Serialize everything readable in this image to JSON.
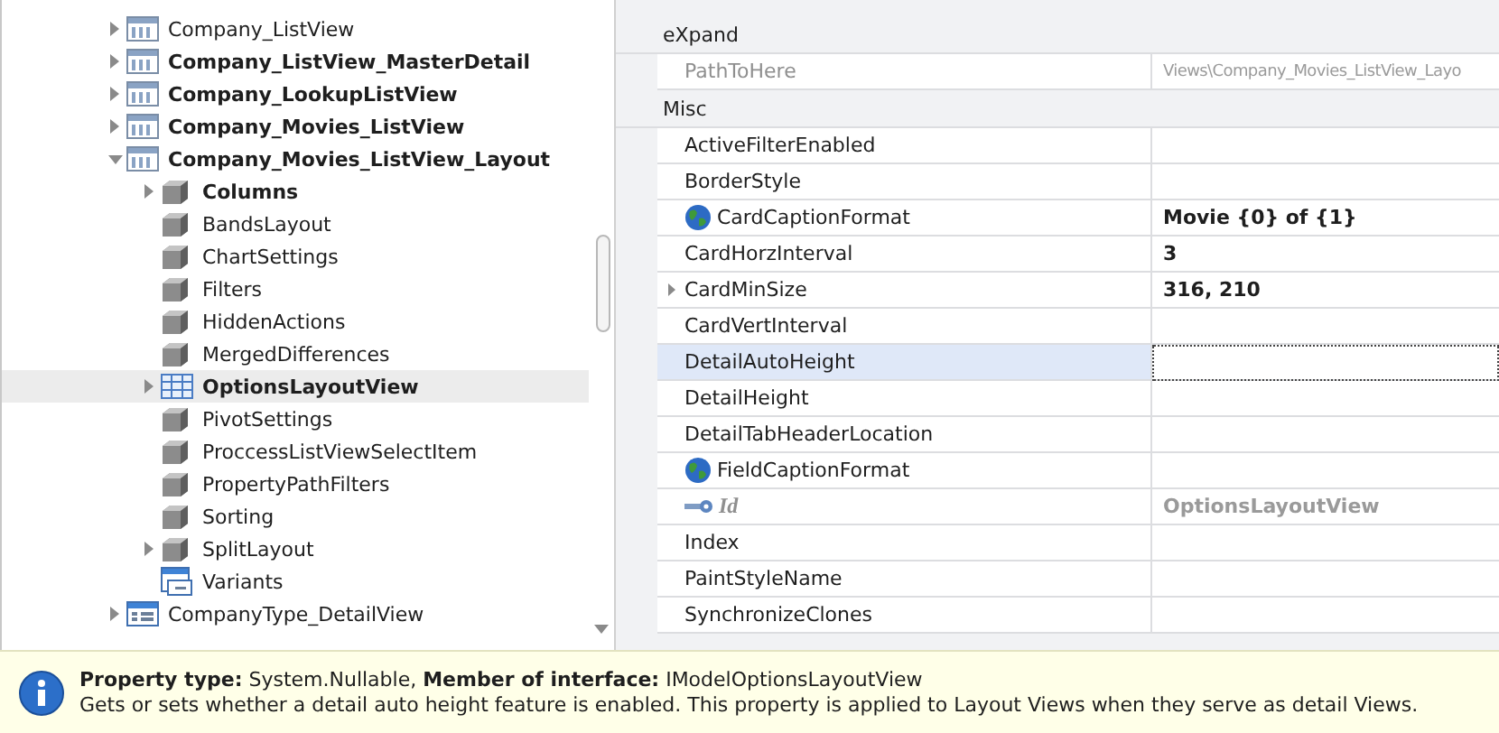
{
  "tree": {
    "items": [
      {
        "label": "Company_ListView",
        "kind": "listview",
        "bold": false,
        "expandable": true,
        "expanded": false,
        "selected": false
      },
      {
        "label": "Company_ListView_MasterDetail",
        "kind": "listview",
        "bold": true,
        "expandable": true,
        "expanded": false,
        "selected": false
      },
      {
        "label": "Company_LookupListView",
        "kind": "listview",
        "bold": true,
        "expandable": true,
        "expanded": false,
        "selected": false
      },
      {
        "label": "Company_Movies_ListView",
        "kind": "listview",
        "bold": true,
        "expandable": true,
        "expanded": false,
        "selected": false
      },
      {
        "label": "Company_Movies_ListView_Layout",
        "kind": "listview",
        "bold": true,
        "expandable": true,
        "expanded": true,
        "selected": false,
        "children": [
          {
            "label": "Columns",
            "kind": "node",
            "bold": true,
            "expandable": true,
            "expanded": false,
            "selected": false
          },
          {
            "label": "BandsLayout",
            "kind": "node",
            "bold": false,
            "expandable": false,
            "selected": false
          },
          {
            "label": "ChartSettings",
            "kind": "node",
            "bold": false,
            "expandable": false,
            "selected": false
          },
          {
            "label": "Filters",
            "kind": "node",
            "bold": false,
            "expandable": false,
            "selected": false
          },
          {
            "label": "HiddenActions",
            "kind": "node",
            "bold": false,
            "expandable": false,
            "selected": false
          },
          {
            "label": "MergedDifferences",
            "kind": "node",
            "bold": false,
            "expandable": false,
            "selected": false
          },
          {
            "label": "OptionsLayoutView",
            "kind": "grid",
            "bold": true,
            "expandable": true,
            "expanded": false,
            "selected": true
          },
          {
            "label": "PivotSettings",
            "kind": "node",
            "bold": false,
            "expandable": false,
            "selected": false
          },
          {
            "label": "ProccessListViewSelectItem",
            "kind": "node",
            "bold": false,
            "expandable": false,
            "selected": false
          },
          {
            "label": "PropertyPathFilters",
            "kind": "node",
            "bold": false,
            "expandable": false,
            "selected": false
          },
          {
            "label": "Sorting",
            "kind": "node",
            "bold": false,
            "expandable": false,
            "selected": false
          },
          {
            "label": "SplitLayout",
            "kind": "node",
            "bold": false,
            "expandable": true,
            "expanded": false,
            "selected": false
          },
          {
            "label": "Variants",
            "kind": "variants",
            "bold": false,
            "expandable": false,
            "selected": false
          }
        ]
      },
      {
        "label": "CompanyType_DetailView",
        "kind": "detailview",
        "bold": false,
        "expandable": true,
        "expanded": false,
        "selected": false
      }
    ]
  },
  "properties": {
    "categories": [
      {
        "name": "eXpand",
        "rows": [
          {
            "name": "PathToHere",
            "value": "Views\\Company_Movies_ListView_Layo",
            "kind": "plain",
            "value_bold": false,
            "readonly": true,
            "expandable": false,
            "selected": false
          }
        ]
      },
      {
        "name": "Misc",
        "rows": [
          {
            "name": "ActiveFilterEnabled",
            "kind": "plain",
            "readonly": false,
            "expandable": false,
            "selected": false
          },
          {
            "name": "BorderStyle",
            "kind": "plain",
            "readonly": false,
            "expandable": false,
            "selected": false
          },
          {
            "name": "CardCaptionFormat",
            "value": "Movie {0} of {1}",
            "kind": "localized",
            "value_bold": true,
            "readonly": false,
            "expandable": false,
            "selected": false
          },
          {
            "name": "CardHorzInterval",
            "value": "3",
            "kind": "plain",
            "value_bold": true,
            "readonly": false,
            "expandable": false,
            "selected": false
          },
          {
            "name": "CardMinSize",
            "value": "316, 210",
            "kind": "plain",
            "value_bold": true,
            "readonly": false,
            "expandable": true,
            "selected": false
          },
          {
            "name": "CardVertInterval",
            "kind": "plain",
            "readonly": false,
            "expandable": false,
            "selected": false
          },
          {
            "name": "DetailAutoHeight",
            "kind": "plain",
            "readonly": false,
            "expandable": false,
            "selected": true
          },
          {
            "name": "DetailHeight",
            "kind": "plain",
            "readonly": false,
            "expandable": false,
            "selected": false
          },
          {
            "name": "DetailTabHeaderLocation",
            "kind": "plain",
            "readonly": false,
            "expandable": false,
            "selected": false
          },
          {
            "name": "FieldCaptionFormat",
            "kind": "localized",
            "readonly": false,
            "expandable": false,
            "selected": false
          },
          {
            "name": "Id",
            "value": "OptionsLayoutView",
            "kind": "key",
            "value_bold": true,
            "readonly": true,
            "expandable": false,
            "selected": false
          },
          {
            "name": "Index",
            "kind": "plain",
            "readonly": false,
            "expandable": false,
            "selected": false
          },
          {
            "name": "PaintStyleName",
            "kind": "plain",
            "readonly": false,
            "expandable": false,
            "selected": false
          },
          {
            "name": "SynchronizeClones",
            "kind": "plain",
            "readonly": false,
            "expandable": false,
            "selected": false
          }
        ]
      }
    ]
  },
  "info": {
    "line1": "**Property type:** System.Nullable, **Member of interface:** IModelOptionsLayoutView",
    "line2": "Gets or sets whether a detail auto height feature is enabled. This property is applied to Layout Views when they serve as detail Views."
  }
}
